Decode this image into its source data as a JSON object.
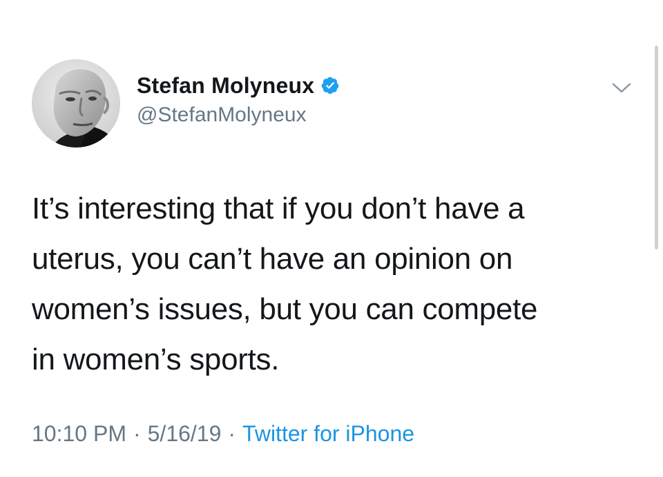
{
  "tweet": {
    "author": {
      "display_name": "Stefan Molyneux",
      "handle": "@StefanMolyneux",
      "verified": true,
      "avatar_icon": "avatar-photo",
      "verified_icon": "verified-badge-icon"
    },
    "text_lines": [
      "It’s interesting that if you don’t have a",
      "uterus, you can’t have an opinion on",
      "women’s issues, but you can compete",
      "in women’s sports."
    ],
    "timestamp": {
      "time": "10:10 PM",
      "date": "5/16/19",
      "separator": "·"
    },
    "source": "Twitter for iPhone",
    "menu_icon": "chevron-down-icon"
  },
  "colors": {
    "text_primary": "#14171a",
    "text_secondary": "#657786",
    "link": "#1b95e0",
    "verified_badge": "#1da1f2",
    "background": "#ffffff"
  }
}
